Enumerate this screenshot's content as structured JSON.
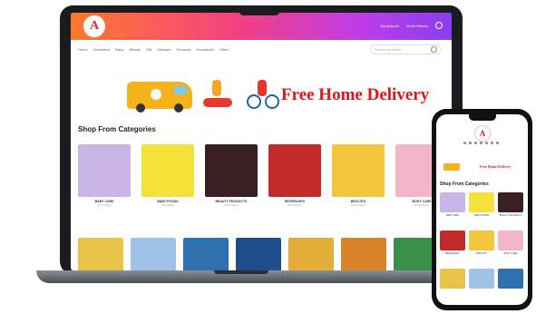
{
  "window": {
    "logo_letter": "A"
  },
  "header": {
    "right_links": [
      "My Account",
      "Order History"
    ]
  },
  "nav": {
    "items": [
      "Home",
      "Cosmetics",
      "Baby",
      "Beauty",
      "Gift",
      "Skincare",
      "Personal",
      "Household",
      "Offers"
    ]
  },
  "search": {
    "placeholder": "Search products"
  },
  "banner": {
    "text": "Free Home Delivery"
  },
  "categories": {
    "heading": "Shop From Categories",
    "items": [
      {
        "label": "BABY CARE",
        "count": "12 Products",
        "color": "#c9b6e6"
      },
      {
        "label": "BABY FOODS",
        "count": "8 Products",
        "color": "#f4e23a"
      },
      {
        "label": "BEAUTY PRODUCTS",
        "count": "24 Products",
        "color": "#3a1f22"
      },
      {
        "label": "BEVERAGES",
        "count": "18 Products",
        "color": "#c22a2a"
      },
      {
        "label": "BISCUITS",
        "count": "15 Products",
        "color": "#f2c53d"
      },
      {
        "label": "BODY CARE",
        "count": "20 Products",
        "color": "#f3b5c9"
      }
    ]
  },
  "row2_colors": [
    "#e7c34a",
    "#9fc3e8",
    "#2e6fb0",
    "#1f4e8c",
    "#e4ad3a",
    "#d8832a",
    "#3a8f4a"
  ],
  "phone": {
    "logo_letter": "A",
    "banner_text": "Free Home Delivery",
    "heading": "Shop From Categories",
    "items": [
      {
        "label": "BABY CARE",
        "color": "#c9b6e6"
      },
      {
        "label": "BABY FOODS",
        "color": "#f4e23a"
      },
      {
        "label": "BEAUTY PRODUCTS",
        "color": "#3a1f22"
      },
      {
        "label": "BEVERAGES",
        "color": "#c22a2a"
      },
      {
        "label": "BISCUITS",
        "color": "#f2c53d"
      },
      {
        "label": "BODY CARE",
        "color": "#f3b5c9"
      },
      {
        "label": "",
        "color": "#e7c34a"
      },
      {
        "label": "",
        "color": "#9fc3e8"
      },
      {
        "label": "",
        "color": "#2e6fb0"
      }
    ]
  }
}
